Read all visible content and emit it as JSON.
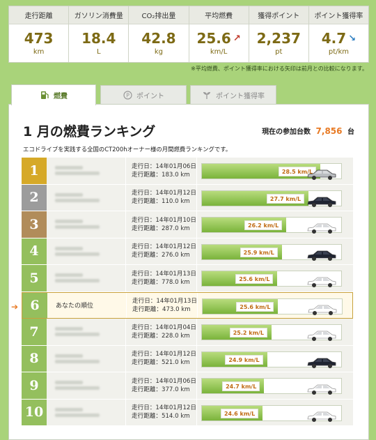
{
  "stats": [
    {
      "label": "走行距離",
      "value": "473",
      "unit": "km",
      "arrow": ""
    },
    {
      "label": "ガソリン消費量",
      "value": "18.4",
      "unit": "L",
      "arrow": ""
    },
    {
      "label": "CO₂排出量",
      "value": "42.8",
      "unit": "kg",
      "arrow": ""
    },
    {
      "label": "平均燃費",
      "value": "25.6",
      "unit": "km/L",
      "arrow": "up"
    },
    {
      "label": "獲得ポイント",
      "value": "2,237",
      "unit": "pt",
      "arrow": ""
    },
    {
      "label": "ポイント獲得率",
      "value": "4.7",
      "unit": "pt/km",
      "arrow": "down"
    }
  ],
  "note": "※平均燃費、ポイント獲得率における矢印は前月との比較になります。",
  "tabs": [
    {
      "label": "燃費",
      "icon": "fuel-pump-icon",
      "active": true
    },
    {
      "label": "ポイント",
      "icon": "points-coin-icon",
      "active": false
    },
    {
      "label": "ポイント獲得率",
      "icon": "sprout-icon",
      "active": false
    }
  ],
  "ranking": {
    "title": "1 月の燃費ランキング",
    "participants_label": "現在の参加台数",
    "participants_count": "7,856",
    "participants_unit": "台",
    "description": "エコドライブを実践する全国のCT200hオーナー様の月間燃費ランキングです。",
    "date_prefix": "走行日：",
    "distance_prefix": "走行距離：",
    "rows": [
      {
        "rank": "1",
        "name": "",
        "date": "14年01月06日",
        "distance": "183.0 km",
        "fuel": "28.5 km/L",
        "fuel_value": 28.5,
        "car": "silver",
        "badge": "gold"
      },
      {
        "rank": "2",
        "name": "",
        "date": "14年01月12日",
        "distance": "110.0 km",
        "fuel": "27.7 km/L",
        "fuel_value": 27.7,
        "car": "black",
        "badge": "silver"
      },
      {
        "rank": "3",
        "name": "",
        "date": "14年01月10日",
        "distance": "287.0 km",
        "fuel": "26.2 km/L",
        "fuel_value": 26.2,
        "car": "white",
        "badge": "bronze"
      },
      {
        "rank": "4",
        "name": "",
        "date": "14年01月12日",
        "distance": "276.0 km",
        "fuel": "25.9 km/L",
        "fuel_value": 25.9,
        "car": "black",
        "badge": "green"
      },
      {
        "rank": "5",
        "name": "",
        "date": "14年01月13日",
        "distance": "778.0 km",
        "fuel": "25.6 km/L",
        "fuel_value": 25.6,
        "car": "white",
        "badge": "green"
      },
      {
        "rank": "6",
        "name": "あなたの順位",
        "date": "14年01月13日",
        "distance": "473.0 km",
        "fuel": "25.6 km/L",
        "fuel_value": 25.6,
        "car": "white",
        "badge": "green",
        "me": true
      },
      {
        "rank": "7",
        "name": "",
        "date": "14年01月04日",
        "distance": "228.0 km",
        "fuel": "25.2 km/L",
        "fuel_value": 25.2,
        "car": "white",
        "badge": "green"
      },
      {
        "rank": "8",
        "name": "",
        "date": "14年01月12日",
        "distance": "521.0 km",
        "fuel": "24.9 km/L",
        "fuel_value": 24.9,
        "car": "black",
        "badge": "green"
      },
      {
        "rank": "9",
        "name": "",
        "date": "14年01月06日",
        "distance": "377.0 km",
        "fuel": "24.7 km/L",
        "fuel_value": 24.7,
        "car": "white",
        "badge": "green"
      },
      {
        "rank": "10",
        "name": "",
        "date": "14年01月12日",
        "distance": "514.0 km",
        "fuel": "24.6 km/L",
        "fuel_value": 24.6,
        "car": "white",
        "badge": "green"
      }
    ]
  },
  "colors": {
    "background": "#a9d37a",
    "value": "#7d6a15",
    "gold": "#d6a928",
    "silver": "#9c9c9c",
    "bronze": "#b18c5a",
    "green": "#94bf5d",
    "accent": "#e87a24"
  }
}
